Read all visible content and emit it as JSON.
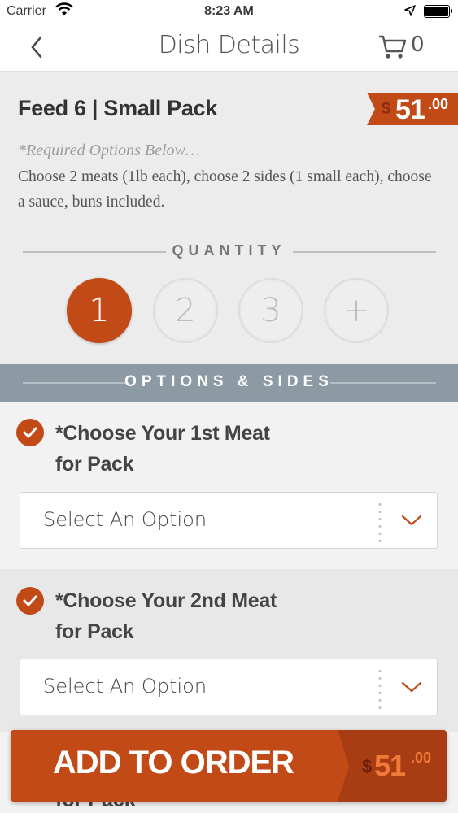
{
  "status_bar": {
    "carrier": "Carrier",
    "time": "8:23 AM"
  },
  "nav": {
    "title": "Dish Details",
    "cart_count": "0"
  },
  "dish": {
    "name": "Feed 6 | Small Pack",
    "price": {
      "currency": "$",
      "whole": "51",
      "cents": ".00"
    },
    "required_note": "*Required Options Below…",
    "description": "Choose 2 meats (1lb each), choose 2 sides (1 small each), choose a sauce, buns included."
  },
  "quantity": {
    "label": "QUANTITY",
    "options": [
      "1",
      "2",
      "3",
      "+"
    ],
    "selected": "1"
  },
  "options_section": {
    "label": "OPTIONS & SIDES"
  },
  "options": [
    {
      "title_line1": "*Choose Your 1st Meat",
      "title_line2": "for Pack",
      "select_value": "Select An Option"
    },
    {
      "title_line1": "*Choose Your 2nd Meat",
      "title_line2": "for Pack",
      "select_value": "Select An Option"
    }
  ],
  "peek_text": "for Pack",
  "add_to_order": {
    "label": "ADD TO ORDER",
    "currency": "$",
    "whole": "51",
    "cents": ".00"
  },
  "colors": {
    "accent": "#c24a17",
    "section_bar": "#8c9aa4"
  },
  "icons": [
    "wifi-icon",
    "location-arrow-icon",
    "battery-icon",
    "back-chevron-icon",
    "cart-icon",
    "check-icon",
    "chevron-down-icon"
  ]
}
